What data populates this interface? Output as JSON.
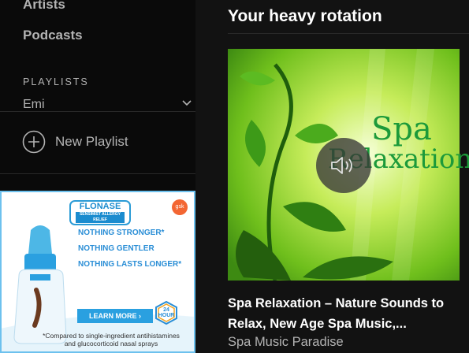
{
  "sidebar": {
    "nav": [
      "Artists",
      "Podcasts"
    ],
    "playlists_heading": "PLAYLISTS",
    "playlists": [
      "Emi"
    ],
    "new_playlist": "New Playlist"
  },
  "ad": {
    "brand": "FLONASE",
    "brand_sub": "SENSIMIST ALLERGY RELIEF",
    "corner_logo": "gsk",
    "claims": [
      "NOTHING STRONGER*",
      "NOTHING GENTLER",
      "NOTHING LASTS LONGER*"
    ],
    "cta": "LEARN MORE",
    "badge": "24 HOUR",
    "footnote": "*Compared to single-ingredient antihistamines and glucocorticoid nasal sprays"
  },
  "main": {
    "title": "Your heavy rotation",
    "album": {
      "cover_text_1": "Spa",
      "cover_text_2": "Relaxation",
      "title": "Spa Relaxation – Nature Sounds to Relax, New Age Spa Music,...",
      "artist": "Spa Music Paradise",
      "hover_icon": "speaker-icon"
    }
  },
  "colors": {
    "background": "#121212",
    "sidebar": "#0a0a0a",
    "muted_text": "#b3b3b3",
    "ad_blue": "#2a8ed6"
  }
}
